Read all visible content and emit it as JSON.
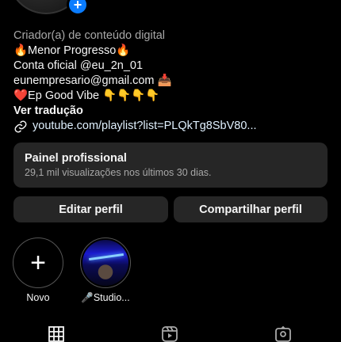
{
  "profile": {
    "add_badge": "+"
  },
  "bio": {
    "category": "Criador(a) de conteúdo digital",
    "line1": "🔥Menor Progresso🔥",
    "line2": "Conta oficial @eu_2n_01",
    "line3": "eunempresario@gmail.com 📥",
    "line4": "❤️Ep Good Vibe 👇👇👇👇",
    "translate": "Ver tradução",
    "link": "youtube.com/playlist?list=PLQkTg8SbV80..."
  },
  "panel": {
    "title": "Painel profissional",
    "subtitle": "29,1 mil visualizações nos últimos 30 dias."
  },
  "buttons": {
    "edit": "Editar perfil",
    "share": "Compartilhar perfil"
  },
  "highlights": [
    {
      "label": "Novo",
      "icon": "plus-icon"
    },
    {
      "label": "🎤Studio...",
      "icon": "studio-image"
    }
  ],
  "tabs": [
    {
      "icon": "grid-icon"
    },
    {
      "icon": "reels-icon"
    },
    {
      "icon": "tagged-icon"
    }
  ]
}
